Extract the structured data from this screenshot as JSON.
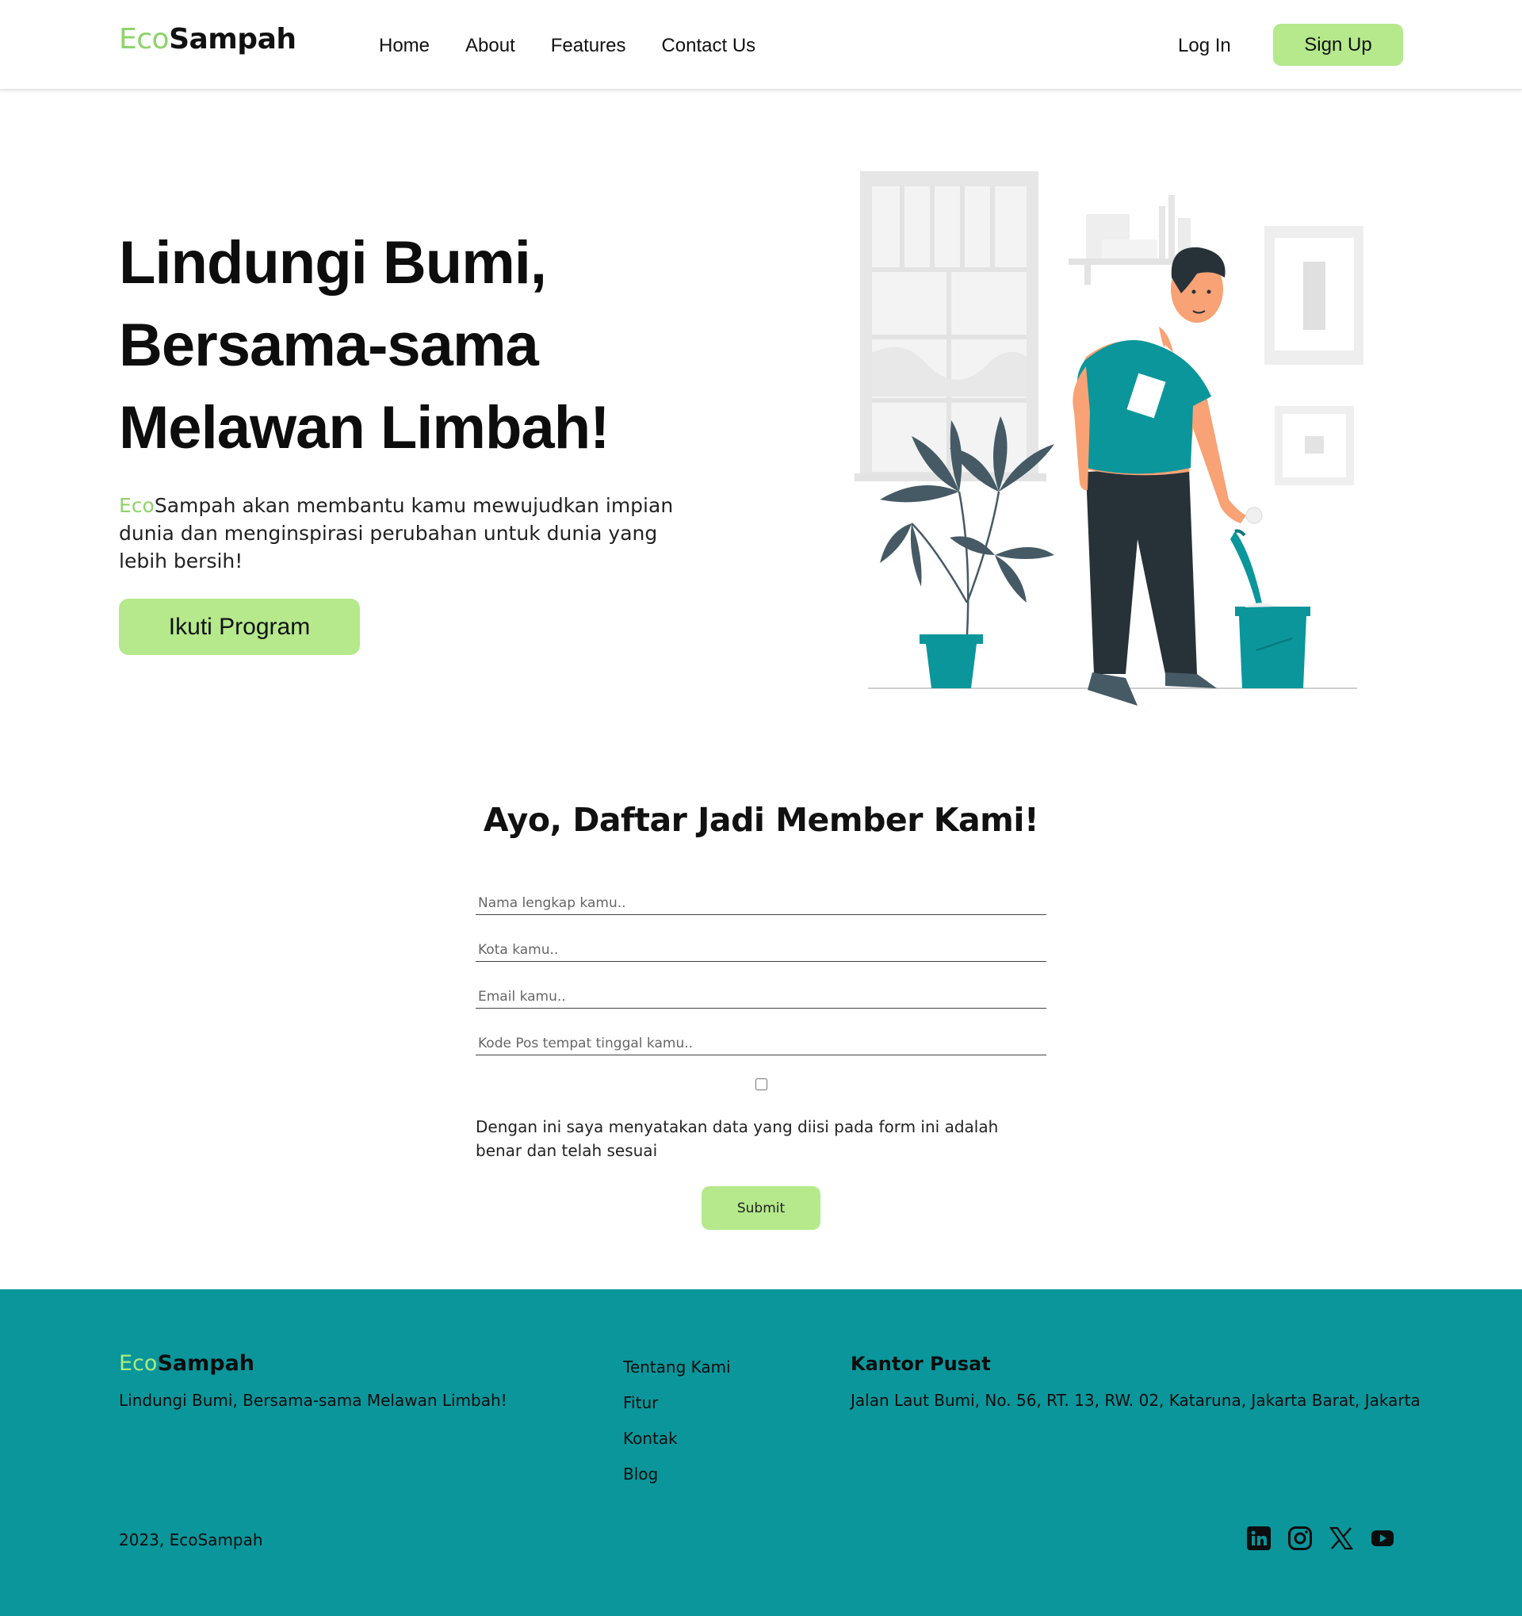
{
  "nav": {
    "logo_eco": "Eco",
    "logo_sampah": "Sampah",
    "links": [
      "Home",
      "About",
      "Features",
      "Contact Us"
    ],
    "login": "Log In",
    "signup": "Sign Up"
  },
  "hero": {
    "title_lines": [
      "Lindungi Bumi,",
      "Bersama-sama",
      "Melawan Limbah!"
    ],
    "desc_eco": "Eco",
    "desc_rest": "Sampah akan membantu kamu mewujudkan impian dunia dan menginspirasi perubahan untuk dunia yang lebih bersih!",
    "cta": "Ikuti Program"
  },
  "form": {
    "title": "Ayo, Daftar Jadi Member Kami!",
    "fields": [
      {
        "placeholder": "Nama lengkap kamu..",
        "value": ""
      },
      {
        "placeholder": "Kota kamu..",
        "value": ""
      },
      {
        "placeholder": "Email kamu..",
        "value": ""
      },
      {
        "placeholder": "Kode Pos tempat tinggal kamu..",
        "value": ""
      }
    ],
    "agree_checked": false,
    "agree_text": "Dengan ini saya menyatakan data yang diisi pada form ini adalah benar dan telah sesuai",
    "submit": "Submit"
  },
  "footer": {
    "logo_eco": "Eco",
    "logo_sampah": "Sampah",
    "tagline": "Lindungi Bumi, Bersama-sama Melawan Limbah!",
    "links": [
      "Tentang Kami",
      "Fitur",
      "Kontak",
      "Blog"
    ],
    "office_title": "Kantor Pusat",
    "office_address": "Jalan Laut Bumi, No. 56, RT. 13, RW. 02, Kataruna, Jakarta Barat, Jakarta",
    "copyright": "2023, EcoSampah",
    "socials": [
      "linkedin-icon",
      "instagram-icon",
      "x-icon",
      "youtube-icon"
    ]
  },
  "colors": {
    "accent": "#b5e98c",
    "eco_green": "#8ed36a",
    "footer_bg": "#0a969b",
    "illustration_teal": "#0b969b",
    "dark_text": "#0d0d0d"
  }
}
